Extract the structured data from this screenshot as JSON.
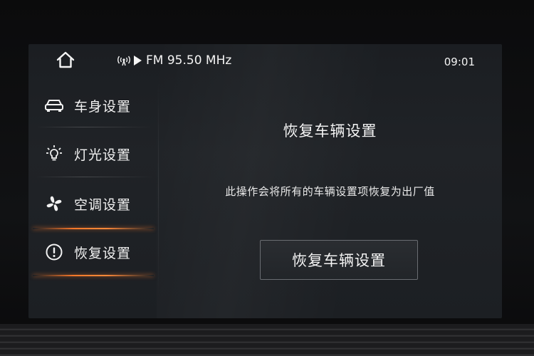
{
  "status": {
    "radio": "FM 95.50 MHz",
    "time": "09:01"
  },
  "sidebar": {
    "items": [
      {
        "label": "车身设置",
        "icon": "car-body-icon"
      },
      {
        "label": "灯光设置",
        "icon": "bulb-icon"
      },
      {
        "label": "空调设置",
        "icon": "fan-icon"
      },
      {
        "label": "恢复设置",
        "icon": "alert-circle-icon",
        "active": true
      }
    ]
  },
  "main": {
    "title": "恢复车辆设置",
    "description": "此操作会将所有的车辆设置项恢复为出厂值",
    "button_label": "恢复车辆设置"
  },
  "colors": {
    "accent": "#ff7a2a",
    "text": "#f2f2f2",
    "screen_bg": "#1e2125"
  }
}
